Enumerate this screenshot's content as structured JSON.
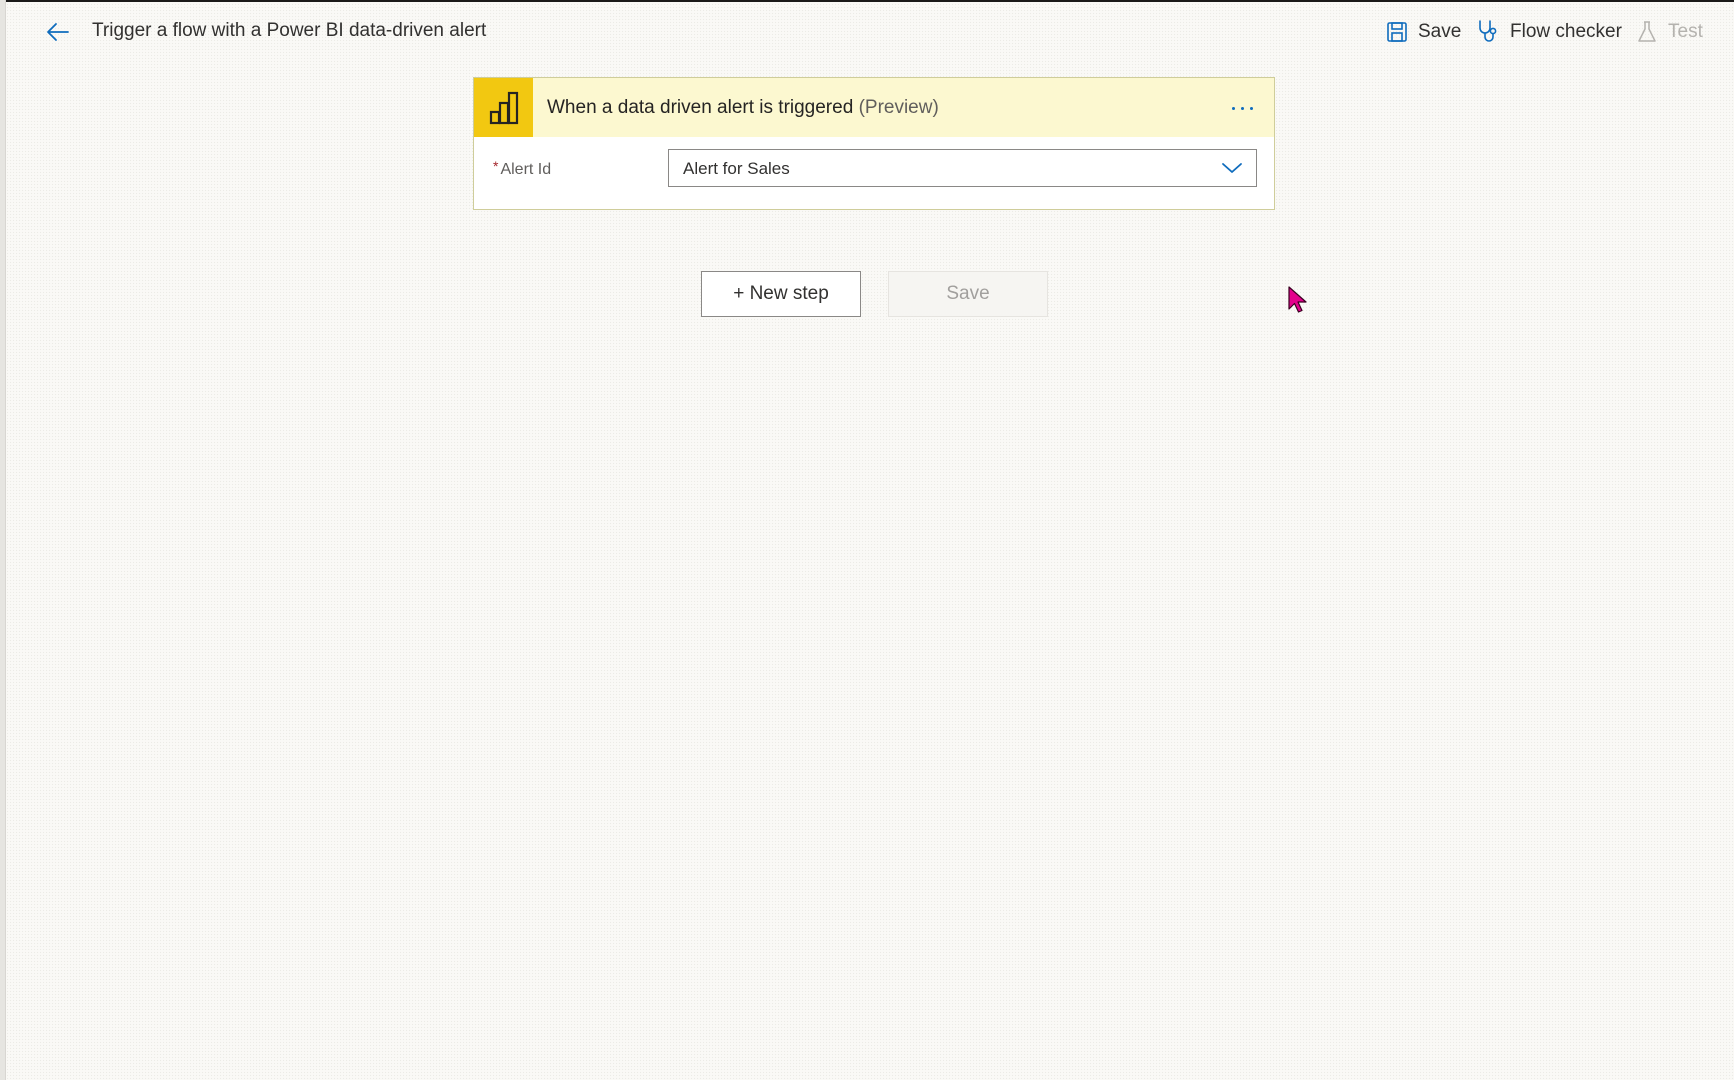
{
  "header": {
    "title": "Trigger a flow with a Power BI data-driven alert",
    "commands": {
      "save": "Save",
      "flow_checker": "Flow checker",
      "test": "Test"
    }
  },
  "trigger_card": {
    "title": "When a data driven alert is triggered",
    "title_suffix": "(Preview)",
    "icon": "power-bi-icon",
    "fields": {
      "alert_id": {
        "label": "Alert Id",
        "required_marker": "*",
        "value": "Alert for Sales"
      }
    }
  },
  "actions": {
    "new_step": "+ New step",
    "save": "Save"
  },
  "colors": {
    "accent": "#0f6cbd",
    "trigger_icon_bg": "#f2c811",
    "trigger_header_bg": "#fcf8d0",
    "cursor": "#e3008c"
  }
}
